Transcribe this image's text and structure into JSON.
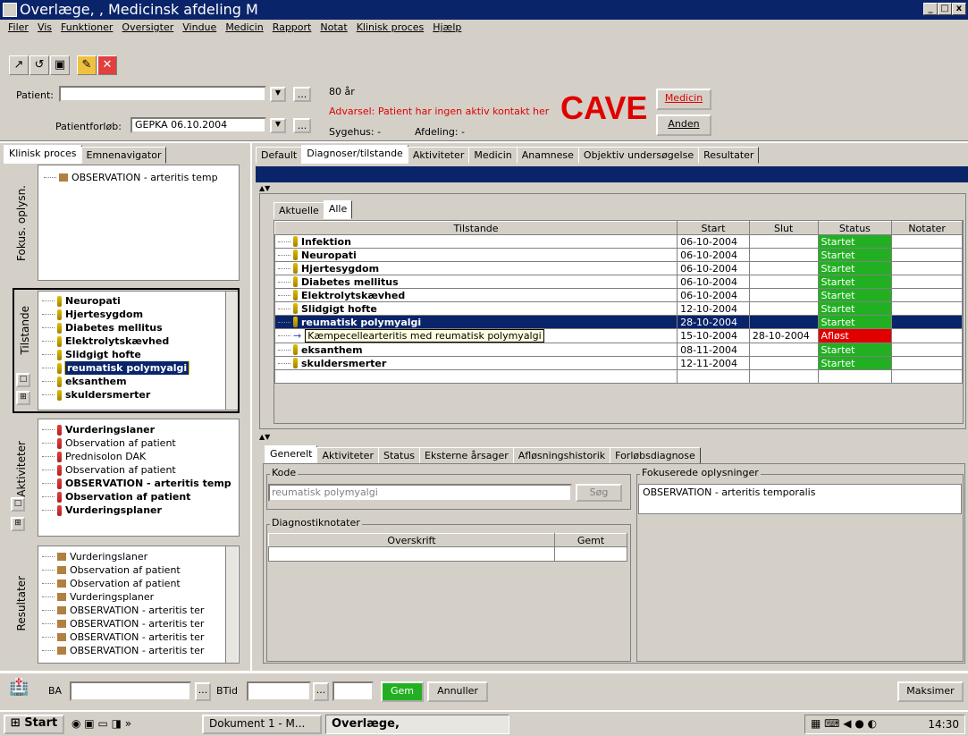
{
  "window": {
    "title": "Overlæge,             , Medicinsk afdeling M"
  },
  "menu": [
    "Filer",
    "Vis",
    "Funktioner",
    "Oversigter",
    "Vindue",
    "Medicin",
    "Rapport",
    "Notat",
    "Klinisk proces",
    "Hjælp"
  ],
  "patient": {
    "label": "Patient:",
    "value": "",
    "age": "80 år",
    "warning": "Advarsel: Patient har ingen aktiv kontakt her",
    "cave": "CAVE",
    "forloeb_label": "Patientforløb:",
    "forloeb_value": "GEPKA 06.10.2004",
    "sygehus": "Sygehus: -",
    "afdeling": "Afdeling: -",
    "medicin_btn": "Medicin",
    "anden_btn": "Anden",
    "dots": "..."
  },
  "left_tabs": [
    "Klinisk proces",
    "Emnenavigator"
  ],
  "fokus": {
    "label": "Fokus. oplysn.",
    "items": [
      "OBSERVATION - arteritis temp"
    ]
  },
  "tilstande": {
    "label": "Tilstande",
    "items": [
      "Neuropati",
      "Hjertesygdom",
      "Diabetes mellitus",
      "Elektrolytskævhed",
      "Slidgigt hofte",
      "reumatisk polymyalgi",
      "eksanthem",
      "skuldersmerter"
    ]
  },
  "aktiviteter": {
    "label": "Aktiviteter",
    "items": [
      {
        "text": "Vurderingslaner",
        "bold": true
      },
      {
        "text": "Observation af patient",
        "bold": false
      },
      {
        "text": "Prednisolon DAK",
        "bold": false
      },
      {
        "text": "Observation af patient",
        "bold": false
      },
      {
        "text": "OBSERVATION - arteritis temp",
        "bold": true
      },
      {
        "text": "Observation af patient",
        "bold": true
      },
      {
        "text": "Vurderingsplaner",
        "bold": true
      }
    ]
  },
  "resultater": {
    "label": "Resultater",
    "items": [
      "Vurderingslaner",
      "Observation af patient",
      "Observation af patient",
      "Vurderingsplaner",
      "OBSERVATION - arteritis ter",
      "OBSERVATION - arteritis ter",
      "OBSERVATION - arteritis ter",
      "OBSERVATION - arteritis ter"
    ]
  },
  "main_tabs": [
    "Default",
    "Diagnoser/tilstande",
    "Aktiviteter",
    "Medicin",
    "Anamnese",
    "Objektiv undersøgelse",
    "Resultater"
  ],
  "sub_tabs": [
    "Aktuelle",
    "Alle"
  ],
  "table": {
    "headers": [
      "Tilstande",
      "Start",
      "Slut",
      "Status",
      "Notater"
    ],
    "rows": [
      {
        "name": "Infektion",
        "start": "06-10-2004",
        "slut": "",
        "status": "Startet",
        "state": "ok"
      },
      {
        "name": "Neuropati",
        "start": "06-10-2004",
        "slut": "",
        "status": "Startet",
        "state": "ok"
      },
      {
        "name": "Hjertesygdom",
        "start": "06-10-2004",
        "slut": "",
        "status": "Startet",
        "state": "ok"
      },
      {
        "name": "Diabetes mellitus",
        "start": "06-10-2004",
        "slut": "",
        "status": "Startet",
        "state": "ok"
      },
      {
        "name": "Elektrolytskævhed",
        "start": "06-10-2004",
        "slut": "",
        "status": "Startet",
        "state": "ok"
      },
      {
        "name": "Slidgigt hofte",
        "start": "12-10-2004",
        "slut": "",
        "status": "Startet",
        "state": "ok"
      },
      {
        "name": "reumatisk polymyalgi",
        "start": "28-10-2004",
        "slut": "",
        "status": "Startet",
        "state": "selected"
      },
      {
        "name": "Kæmpecellearteritis med reumatisk polymyalgi",
        "start": "15-10-2004",
        "slut": "28-10-2004",
        "status": "Afløst",
        "state": "bad"
      },
      {
        "name": "eksanthem",
        "start": "08-11-2004",
        "slut": "",
        "status": "Startet",
        "state": "ok"
      },
      {
        "name": "skuldersmerter",
        "start": "12-11-2004",
        "slut": "",
        "status": "Startet",
        "state": "ok"
      }
    ]
  },
  "detail_tabs": [
    "Generelt",
    "Aktiviteter",
    "Status",
    "Eksterne årsager",
    "Afløsningshistorik",
    "Forløbsdiagnose"
  ],
  "detail": {
    "kode_label": "Kode",
    "kode_value": "reumatisk polymyalgi",
    "soeg": "Søg",
    "fokus_label": "Fokuserede oplysninger",
    "fokus_value": "OBSERVATION - arteritis temporalis",
    "diag_label": "Diagnostiknotater",
    "diag_headers": [
      "Overskrift",
      "Gemt"
    ]
  },
  "bottom": {
    "ba": "BA",
    "btid": "BTid",
    "gem": "Gem",
    "annuller": "Annuller",
    "maksimer": "Maksimer",
    "dots": "..."
  },
  "taskbar": {
    "start": "Start",
    "item1": "Dokument 1 - M...",
    "item2": "Overlæge,",
    "clock": "14:30"
  },
  "colors": {
    "title": "#0a246a",
    "ok": "#22b022",
    "bad": "#e00000",
    "warning": "#e00000"
  }
}
